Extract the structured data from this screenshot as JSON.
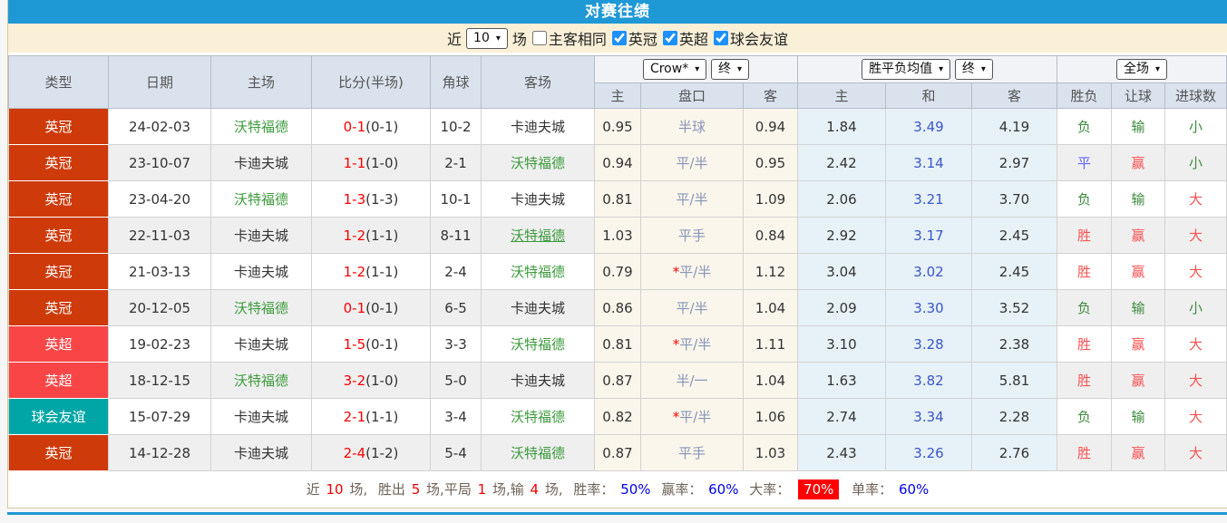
{
  "title": "对赛往绩",
  "filter": {
    "recent_label": "近",
    "recent_value": "10",
    "matches_label": "场",
    "same_venue_label": "主客相同",
    "same_venue_checked": false,
    "leagues": [
      {
        "label": "英冠",
        "checked": true
      },
      {
        "label": "英超",
        "checked": true
      },
      {
        "label": "球会友谊",
        "checked": true
      }
    ]
  },
  "table": {
    "selects": {
      "odds_source": "Crow*",
      "odds_time": "终",
      "avg_label": "胜平负均值",
      "avg_time": "终",
      "scope": "全场"
    },
    "headers": {
      "type": "类型",
      "date": "日期",
      "home": "主场",
      "score": "比分(半场)",
      "corner": "角球",
      "away": "客场",
      "crow_home": "主",
      "handicap": "盘口",
      "crow_away": "客",
      "avg_home": "主",
      "avg_draw": "和",
      "avg_away": "客",
      "result": "胜负",
      "let_result": "让球",
      "goals": "进球数"
    }
  },
  "rows": [
    {
      "league": "英冠",
      "league_class": "lg-yg",
      "date": "24-02-03",
      "home": "沃特福德",
      "score": "0-1",
      "half": "(0-1)",
      "corner": "10-2",
      "away": "卡迪夫城",
      "away_class": "",
      "crow_home": "0.95",
      "handicap_star": "",
      "handicap": "半球",
      "crow_away": "0.94",
      "avg_home": "1.84",
      "avg_draw": "3.49",
      "avg_away": "4.19",
      "result": "负",
      "let_result": "输",
      "goals": "小"
    },
    {
      "league": "英冠",
      "league_class": "lg-yg",
      "date": "23-10-07",
      "home": "卡迪夫城",
      "score": "1-1",
      "half": "(1-0)",
      "corner": "2-1",
      "away": "沃特福德",
      "away_class": "",
      "crow_home": "0.94",
      "handicap_star": "",
      "handicap": "平/半",
      "crow_away": "0.95",
      "avg_home": "2.42",
      "avg_draw": "3.14",
      "avg_away": "2.97",
      "result": "平",
      "let_result": "赢",
      "goals": "小"
    },
    {
      "league": "英冠",
      "league_class": "lg-yg",
      "date": "23-04-20",
      "home": "沃特福德",
      "score": "1-3",
      "half": "(1-3)",
      "corner": "10-1",
      "away": "卡迪夫城",
      "away_class": "",
      "crow_home": "0.81",
      "handicap_star": "",
      "handicap": "平/半",
      "crow_away": "1.09",
      "avg_home": "2.06",
      "avg_draw": "3.21",
      "avg_away": "3.70",
      "result": "负",
      "let_result": "输",
      "goals": "大"
    },
    {
      "league": "英冠",
      "league_class": "lg-yg",
      "date": "22-11-03",
      "home": "卡迪夫城",
      "score": "1-2",
      "half": "(1-1)",
      "corner": "8-11",
      "away": "沃特福德",
      "away_class": "u",
      "crow_home": "1.03",
      "handicap_star": "",
      "handicap": "平手",
      "crow_away": "0.84",
      "avg_home": "2.92",
      "avg_draw": "3.17",
      "avg_away": "2.45",
      "result": "胜",
      "let_result": "赢",
      "goals": "大"
    },
    {
      "league": "英冠",
      "league_class": "lg-yg",
      "date": "21-03-13",
      "home": "卡迪夫城",
      "score": "1-2",
      "half": "(1-1)",
      "corner": "2-4",
      "away": "沃特福德",
      "away_class": "",
      "crow_home": "0.79",
      "handicap_star": "*",
      "handicap": "平/半",
      "crow_away": "1.12",
      "avg_home": "3.04",
      "avg_draw": "3.02",
      "avg_away": "2.45",
      "result": "胜",
      "let_result": "赢",
      "goals": "大"
    },
    {
      "league": "英冠",
      "league_class": "lg-yg",
      "date": "20-12-05",
      "home": "沃特福德",
      "score": "0-1",
      "half": "(0-1)",
      "corner": "6-5",
      "away": "卡迪夫城",
      "away_class": "",
      "crow_home": "0.86",
      "handicap_star": "",
      "handicap": "平/半",
      "crow_away": "1.04",
      "avg_home": "2.09",
      "avg_draw": "3.30",
      "avg_away": "3.52",
      "result": "负",
      "let_result": "输",
      "goals": "小"
    },
    {
      "league": "英超",
      "league_class": "lg-yc",
      "date": "19-02-23",
      "home": "卡迪夫城",
      "score": "1-5",
      "half": "(0-1)",
      "corner": "3-3",
      "away": "沃特福德",
      "away_class": "",
      "crow_home": "0.81",
      "handicap_star": "*",
      "handicap": "平/半",
      "crow_away": "1.11",
      "avg_home": "3.10",
      "avg_draw": "3.28",
      "avg_away": "2.38",
      "result": "胜",
      "let_result": "赢",
      "goals": "大"
    },
    {
      "league": "英超",
      "league_class": "lg-yc",
      "date": "18-12-15",
      "home": "沃特福德",
      "score": "3-2",
      "half": "(1-0)",
      "corner": "5-0",
      "away": "卡迪夫城",
      "away_class": "",
      "crow_home": "0.87",
      "handicap_star": "",
      "handicap": "半/一",
      "crow_away": "1.04",
      "avg_home": "1.63",
      "avg_draw": "3.82",
      "avg_away": "5.81",
      "result": "胜",
      "let_result": "赢",
      "goals": "大"
    },
    {
      "league": "球会友谊",
      "league_class": "lg-qh",
      "date": "15-07-29",
      "home": "卡迪夫城",
      "score": "2-1",
      "half": "(1-1)",
      "corner": "3-4",
      "away": "沃特福德",
      "away_class": "",
      "crow_home": "0.82",
      "handicap_star": "*",
      "handicap": "平/半",
      "crow_away": "1.06",
      "avg_home": "2.74",
      "avg_draw": "3.34",
      "avg_away": "2.28",
      "result": "负",
      "let_result": "输",
      "goals": "大"
    },
    {
      "league": "英冠",
      "league_class": "lg-yg",
      "date": "14-12-28",
      "home": "卡迪夫城",
      "score": "2-4",
      "half": "(1-2)",
      "corner": "5-4",
      "away": "沃特福德",
      "away_class": "",
      "crow_home": "0.87",
      "handicap_star": "",
      "handicap": "平手",
      "crow_away": "1.03",
      "avg_home": "2.43",
      "avg_draw": "3.26",
      "avg_away": "2.76",
      "result": "胜",
      "let_result": "赢",
      "goals": "大"
    }
  ],
  "summary": {
    "recent_label": "近",
    "total": "10",
    "total_suffix": "场,",
    "win_label": "胜出",
    "wins": "5",
    "win_suffix": "场,平局",
    "draws": "1",
    "draw_suffix": "场,输",
    "losses": "4",
    "loss_suffix": "场,",
    "rate1_label": "胜率：",
    "rate1": "50%",
    "rate2_label": "赢率：",
    "rate2": "60%",
    "rate3_label": "大率：",
    "rate3": "70%",
    "rate4_label": "单率：",
    "rate4": "60%"
  },
  "colors": {
    "title_bar": "#1f98d6",
    "filter_bar": "#faf0d8",
    "header_bg": "#dae3ed",
    "league_championship": "#cf3a0a",
    "league_premier": "#f94546",
    "league_friendly": "#00a5a5",
    "score_red": "#ff0000",
    "team_green": "#3d9b3d",
    "handicap_gray_blue": "#8695b8",
    "avg_draw_blue": "#3a57c8",
    "result_red": "#fa5252",
    "result_green": "#3d8b3d",
    "result_draw_blue": "#6666ff",
    "percent_blue": "#0000ee",
    "count_red": "#ee0000",
    "highlight_badge_bg": "#ff0000"
  },
  "icons": {
    "chevron_down": "▾"
  }
}
